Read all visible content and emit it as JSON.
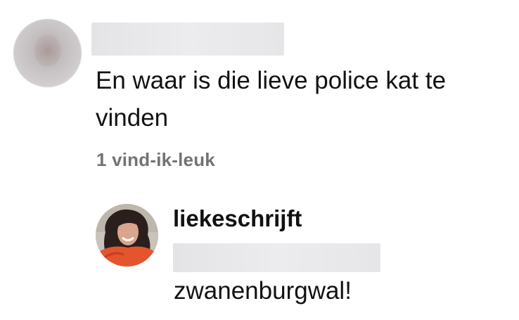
{
  "comment": {
    "avatar_icon": "blurred-avatar-icon",
    "author_redacted": true,
    "text": "En waar is die lieve police kat te vinden",
    "likes_label": "1 vind-ik-leuk"
  },
  "reply": {
    "avatar_icon": "profile-photo-icon",
    "username": "liekeschrijft",
    "mention_redacted": true,
    "text": "zwanenburgwal!"
  },
  "colors": {
    "text": "#121212",
    "secondary": "#737373",
    "redaction": "#e8e8ea"
  }
}
